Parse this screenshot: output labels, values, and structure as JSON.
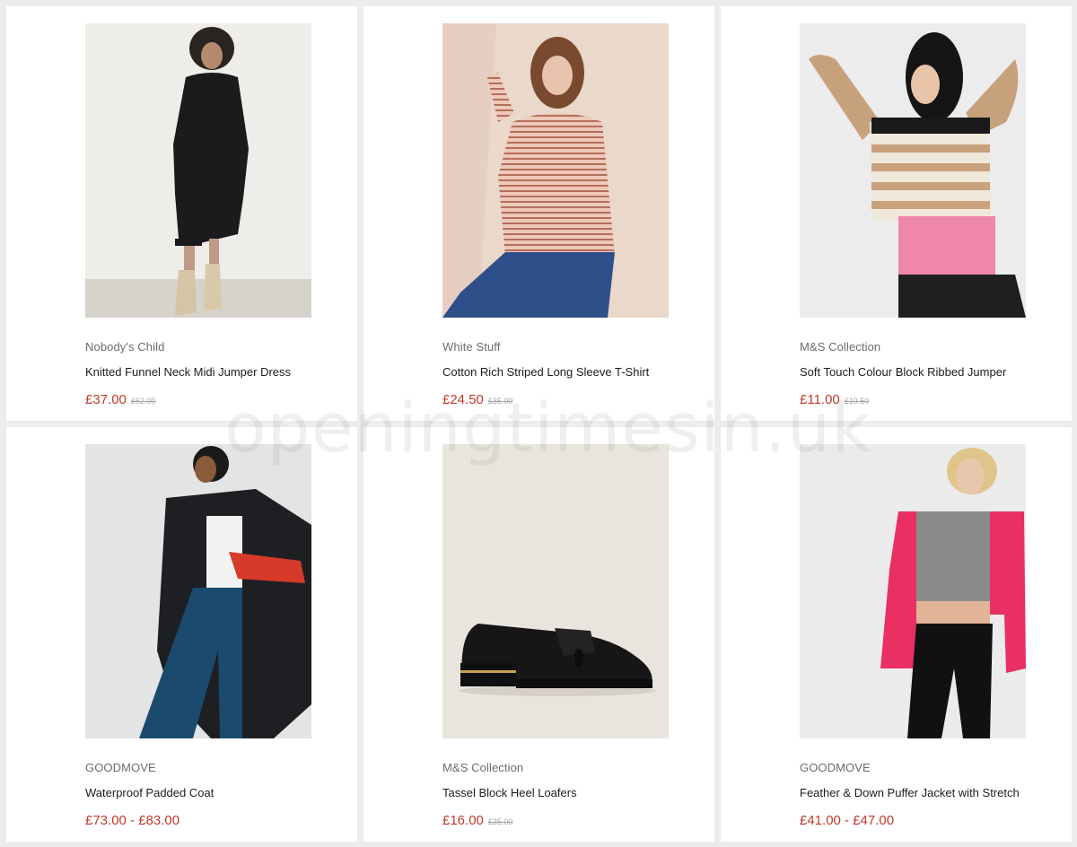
{
  "watermark": "openingtimesin.uk",
  "products": [
    {
      "brand": "Nobody's Child",
      "title": "Knitted Funnel Neck Midi Jumper Dress",
      "price": "£37.00",
      "was": "£62.00"
    },
    {
      "brand": "White Stuff",
      "title": "Cotton Rich Striped Long Sleeve T-Shirt",
      "price": "£24.50",
      "was": "£35.00"
    },
    {
      "brand": "M&S Collection",
      "title": "Soft Touch Colour Block Ribbed Jumper",
      "price": "£11.00",
      "was": "£19.50"
    },
    {
      "brand": "GOODMOVE",
      "title": "Waterproof Padded Coat",
      "price": "£73.00 - £83.00",
      "was": ""
    },
    {
      "brand": "M&S Collection",
      "title": "Tassel Block Heel Loafers",
      "price": "£16.00",
      "was": "£35.00"
    },
    {
      "brand": "GOODMOVE",
      "title": "Feather & Down Puffer Jacket with Stretch",
      "price": "£41.00 - £47.00",
      "was": ""
    }
  ],
  "colors": {
    "page_background": "#ececec",
    "card_background": "#ffffff",
    "price": "#c0392b",
    "was_price": "#a5a5a5",
    "brand": "#6b6b6b"
  }
}
